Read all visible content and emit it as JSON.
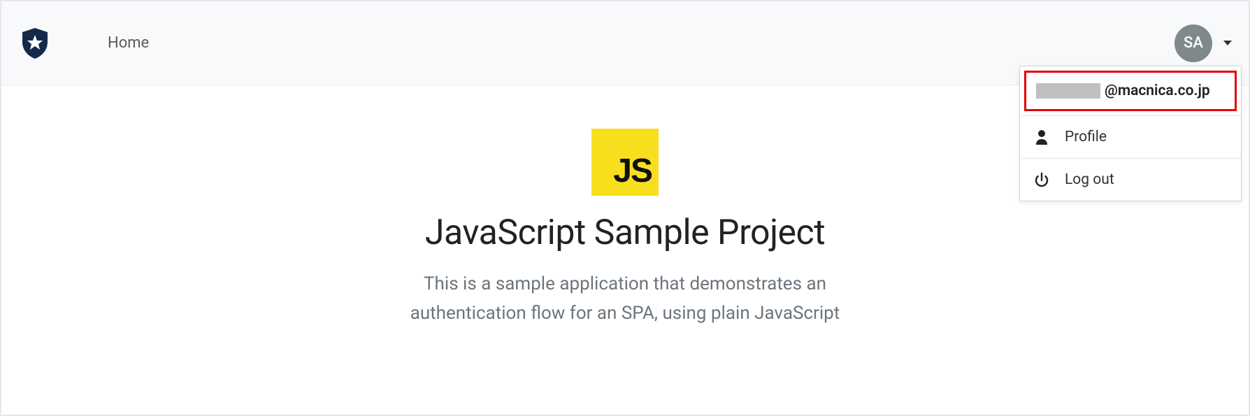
{
  "nav": {
    "home_label": "Home",
    "avatar_initials": "SA"
  },
  "dropdown": {
    "email_suffix": "@macnica.co.jp",
    "profile_label": "Profile",
    "logout_label": "Log out"
  },
  "hero": {
    "badge_text": "JS",
    "title": "JavaScript Sample Project",
    "subtitle": "This is a sample application that demonstrates an authentication flow for an SPA, using plain JavaScript"
  }
}
